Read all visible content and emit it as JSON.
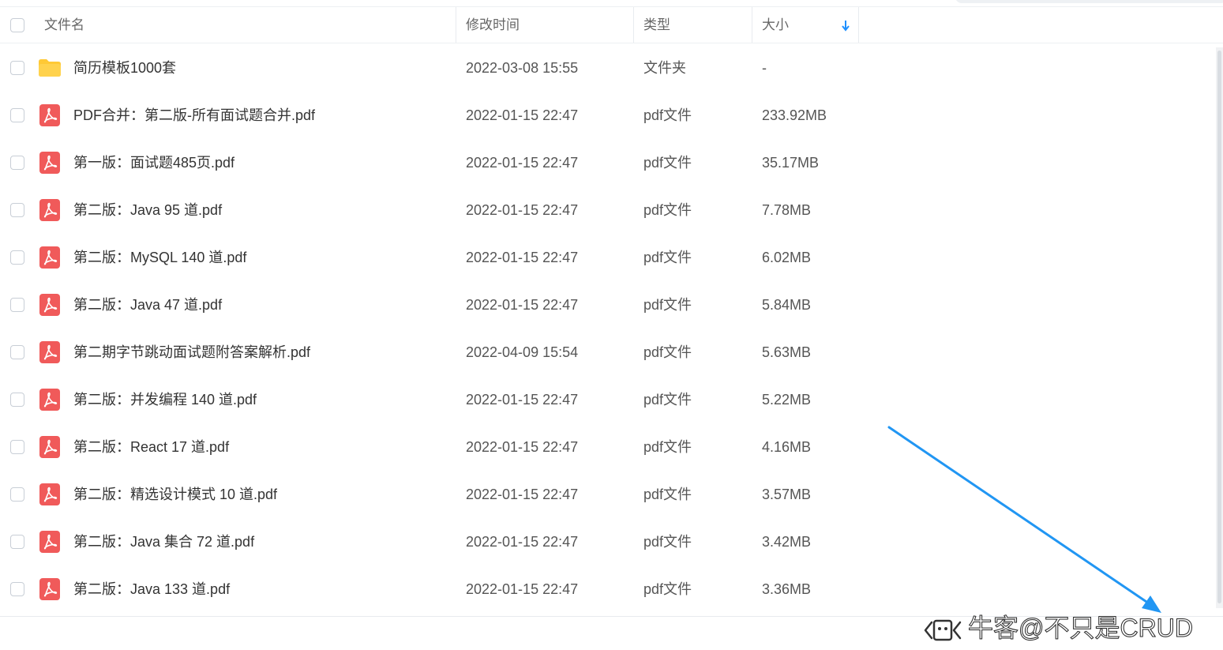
{
  "header": {
    "name_label": "文件名",
    "modified_label": "修改时间",
    "type_label": "类型",
    "size_label": "大小",
    "sort_icon": "arrow-down-icon"
  },
  "files": [
    {
      "name": "简历模板1000套",
      "modified": "2022-03-08 15:55",
      "type": "文件夹",
      "size": "-",
      "icon": "folder-icon"
    },
    {
      "name": "PDF合并：第二版-所有面试题合并.pdf",
      "modified": "2022-01-15 22:47",
      "type": "pdf文件",
      "size": "233.92MB",
      "icon": "pdf-icon"
    },
    {
      "name": "第一版：面试题485页.pdf",
      "modified": "2022-01-15 22:47",
      "type": "pdf文件",
      "size": "35.17MB",
      "icon": "pdf-icon"
    },
    {
      "name": "第二版：Java 95 道.pdf",
      "modified": "2022-01-15 22:47",
      "type": "pdf文件",
      "size": "7.78MB",
      "icon": "pdf-icon"
    },
    {
      "name": "第二版：MySQL 140 道.pdf",
      "modified": "2022-01-15 22:47",
      "type": "pdf文件",
      "size": "6.02MB",
      "icon": "pdf-icon"
    },
    {
      "name": "第二版：Java 47  道.pdf",
      "modified": "2022-01-15 22:47",
      "type": "pdf文件",
      "size": "5.84MB",
      "icon": "pdf-icon"
    },
    {
      "name": "第二期字节跳动面试题附答案解析.pdf",
      "modified": "2022-04-09 15:54",
      "type": "pdf文件",
      "size": "5.63MB",
      "icon": "pdf-icon"
    },
    {
      "name": "第二版：并发编程 140 道.pdf",
      "modified": "2022-01-15 22:47",
      "type": "pdf文件",
      "size": "5.22MB",
      "icon": "pdf-icon"
    },
    {
      "name": "第二版：React 17 道.pdf",
      "modified": "2022-01-15 22:47",
      "type": "pdf文件",
      "size": "4.16MB",
      "icon": "pdf-icon"
    },
    {
      "name": "第二版：精选设计模式 10 道.pdf",
      "modified": "2022-01-15 22:47",
      "type": "pdf文件",
      "size": "3.57MB",
      "icon": "pdf-icon"
    },
    {
      "name": "第二版：Java 集合 72 道.pdf",
      "modified": "2022-01-15 22:47",
      "type": "pdf文件",
      "size": "3.42MB",
      "icon": "pdf-icon"
    },
    {
      "name": "第二版：Java 133 道.pdf",
      "modified": "2022-01-15 22:47",
      "type": "pdf文件",
      "size": "3.36MB",
      "icon": "pdf-icon"
    }
  ],
  "watermark": {
    "text": "牛客@不只是CRUD"
  },
  "colors": {
    "accent": "#1e90ff",
    "pdf_red": "#f05a5a",
    "folder_yellow": "#ffc935",
    "arrow_blue": "#2196f3"
  }
}
